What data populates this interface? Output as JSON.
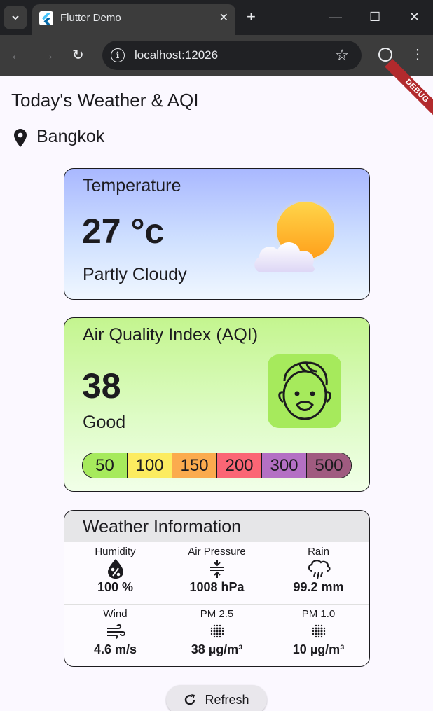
{
  "browser": {
    "tab_title": "Flutter Demo",
    "url": "localhost:12026"
  },
  "app": {
    "title": "Today's Weather & AQI",
    "location": "Bangkok",
    "debug_banner": "DEBUG"
  },
  "temperature": {
    "heading": "Temperature",
    "value": "27 °c",
    "condition": "Partly Cloudy",
    "icon": "partly-cloudy-icon"
  },
  "aqi": {
    "heading": "Air Quality Index (AQI)",
    "value": "38",
    "level": "Good",
    "icon": "smiling-face-icon",
    "scale": [
      {
        "label": "50",
        "color": "#a6ea5c"
      },
      {
        "label": "100",
        "color": "#fcec60"
      },
      {
        "label": "150",
        "color": "#fbab4e"
      },
      {
        "label": "200",
        "color": "#fb6675"
      },
      {
        "label": "300",
        "color": "#b470c4"
      },
      {
        "label": "500",
        "color": "#a05b80"
      }
    ]
  },
  "weather_info": {
    "heading": "Weather Information",
    "items": [
      {
        "label": "Humidity",
        "value": "100 %",
        "icon": "humidity-percent-icon"
      },
      {
        "label": "Air Pressure",
        "value": "1008 hPa",
        "icon": "compress-icon"
      },
      {
        "label": "Rain",
        "value": "99.2 mm",
        "icon": "rain-cloud-icon"
      },
      {
        "label": "Wind",
        "value": "4.6 m/s",
        "icon": "wind-icon"
      },
      {
        "label": "PM 2.5",
        "value": "38 µg/m³",
        "icon": "particles-icon"
      },
      {
        "label": "PM 1.0",
        "value": "10 µg/m³",
        "icon": "particles-icon"
      }
    ]
  },
  "refresh_label": "Refresh"
}
